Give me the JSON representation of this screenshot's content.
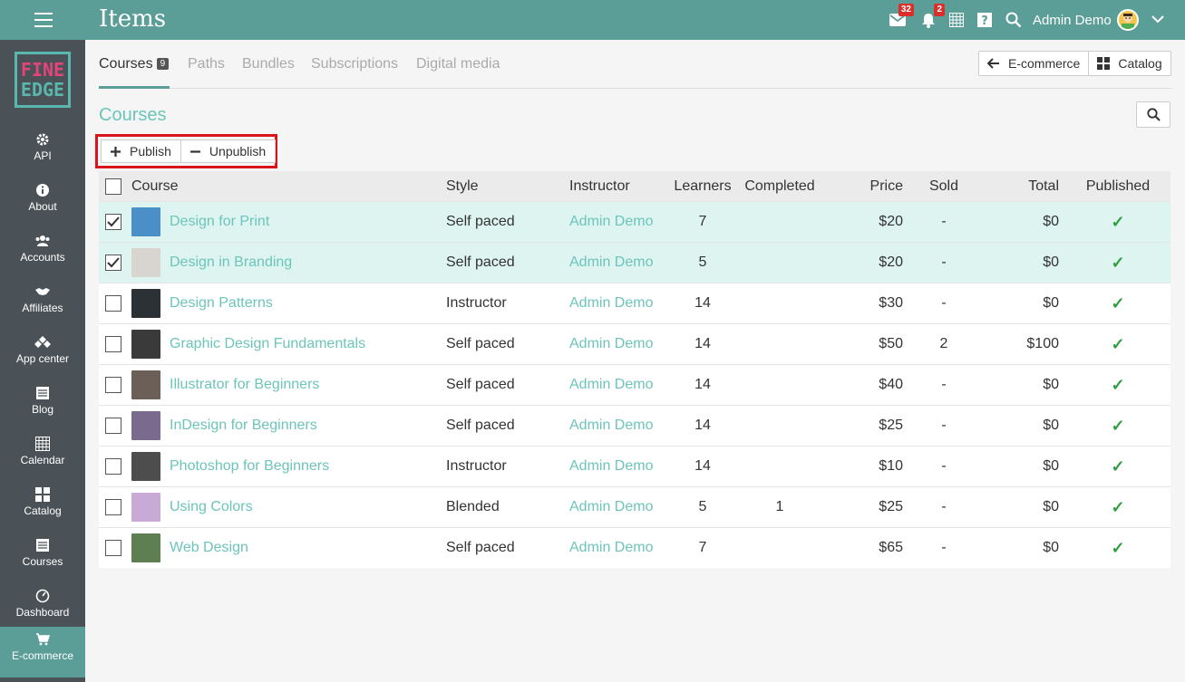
{
  "header": {
    "title": "Items",
    "messages_badge": "32",
    "notifications_badge": "2",
    "user_name": "Admin Demo"
  },
  "logo": {
    "line1": "FINE",
    "line2": "EDGE"
  },
  "sidebar": {
    "items": [
      {
        "label": "API",
        "icon": "gear-icon"
      },
      {
        "label": "About",
        "icon": "info-icon"
      },
      {
        "label": "Accounts",
        "icon": "users-icon"
      },
      {
        "label": "Affiliates",
        "icon": "handshake-icon"
      },
      {
        "label": "App center",
        "icon": "diamond-icon"
      },
      {
        "label": "Blog",
        "icon": "list-icon"
      },
      {
        "label": "Calendar",
        "icon": "calendar-icon"
      },
      {
        "label": "Catalog",
        "icon": "grid-icon"
      },
      {
        "label": "Courses",
        "icon": "list-icon"
      },
      {
        "label": "Dashboard",
        "icon": "dashboard-icon"
      },
      {
        "label": "E-commerce",
        "icon": "cart-icon",
        "active": true
      }
    ]
  },
  "tabs": [
    {
      "label": "Courses",
      "count": "9",
      "active": true
    },
    {
      "label": "Paths"
    },
    {
      "label": "Bundles"
    },
    {
      "label": "Subscriptions"
    },
    {
      "label": "Digital media"
    }
  ],
  "toolbar": {
    "ecommerce_label": "E-commerce",
    "catalog_label": "Catalog"
  },
  "section": {
    "title": "Courses"
  },
  "actions": {
    "publish_label": "Publish",
    "unpublish_label": "Unpublish"
  },
  "table": {
    "columns": [
      "Course",
      "Style",
      "Instructor",
      "Learners",
      "Completed",
      "Price",
      "Sold",
      "Total",
      "Published"
    ],
    "rows": [
      {
        "course": "Design for Print",
        "style": "Self paced",
        "instructor": "Admin Demo",
        "learners": "7",
        "completed": "",
        "price": "$20",
        "sold": "-",
        "total": "$0",
        "published": "✓",
        "checked": true,
        "thumb_color": "#4a8fc8"
      },
      {
        "course": "Design in Branding",
        "style": "Self paced",
        "instructor": "Admin Demo",
        "learners": "5",
        "completed": "",
        "price": "$20",
        "sold": "-",
        "total": "$0",
        "published": "✓",
        "checked": true,
        "thumb_color": "#d8d4cf"
      },
      {
        "course": "Design Patterns",
        "style": "Instructor",
        "instructor": "Admin Demo",
        "learners": "14",
        "completed": "",
        "price": "$30",
        "sold": "-",
        "total": "$0",
        "published": "✓",
        "checked": false,
        "thumb_color": "#2c3136"
      },
      {
        "course": "Graphic Design Fundamentals",
        "style": "Self paced",
        "instructor": "Admin Demo",
        "learners": "14",
        "completed": "",
        "price": "$50",
        "sold": "2",
        "total": "$100",
        "published": "✓",
        "checked": false,
        "thumb_color": "#3a3a3a"
      },
      {
        "course": "Illustrator for Beginners",
        "style": "Self paced",
        "instructor": "Admin Demo",
        "learners": "14",
        "completed": "",
        "price": "$40",
        "sold": "-",
        "total": "$0",
        "published": "✓",
        "checked": false,
        "thumb_color": "#6b5f58"
      },
      {
        "course": "InDesign for Beginners",
        "style": "Self paced",
        "instructor": "Admin Demo",
        "learners": "14",
        "completed": "",
        "price": "$25",
        "sold": "-",
        "total": "$0",
        "published": "✓",
        "checked": false,
        "thumb_color": "#7a6a8e"
      },
      {
        "course": "Photoshop for Beginners",
        "style": "Instructor",
        "instructor": "Admin Demo",
        "learners": "14",
        "completed": "",
        "price": "$10",
        "sold": "-",
        "total": "$0",
        "published": "✓",
        "checked": false,
        "thumb_color": "#4d4d4d"
      },
      {
        "course": "Using Colors",
        "style": "Blended",
        "instructor": "Admin Demo",
        "learners": "5",
        "completed": "1",
        "price": "$25",
        "sold": "-",
        "total": "$0",
        "published": "✓",
        "checked": false,
        "thumb_color": "#c9a9d6"
      },
      {
        "course": "Web Design",
        "style": "Self paced",
        "instructor": "Admin Demo",
        "learners": "7",
        "completed": "",
        "price": "$65",
        "sold": "-",
        "total": "$0",
        "published": "✓",
        "checked": false,
        "thumb_color": "#5e7f52"
      }
    ]
  },
  "colors": {
    "topbar": "#5a9e97",
    "sidebar": "#4b5257",
    "accent": "#6cc5ba",
    "selected_row": "#ddf4f1",
    "check_green": "#2e9e3e",
    "highlight": "#d9151b"
  }
}
